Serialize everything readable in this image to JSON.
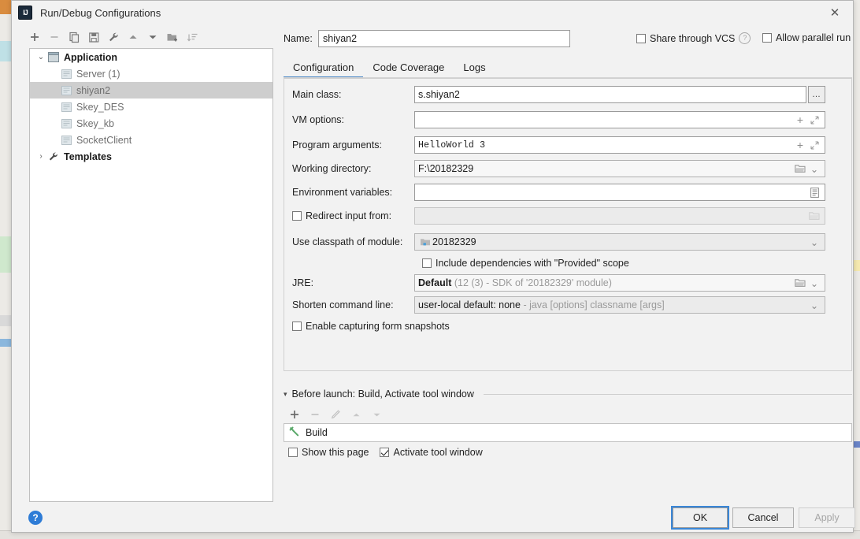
{
  "window": {
    "title": "Run/Debug Configurations",
    "app_icon": "intellij-idea-icon",
    "close_label": "✕"
  },
  "left_toolbar": {
    "buttons": [
      {
        "name": "add-configuration-button",
        "label": "+"
      },
      {
        "name": "remove-configuration-button",
        "label": "−"
      },
      {
        "name": "copy-configuration-button",
        "label": "copy-icon"
      },
      {
        "name": "save-configuration-button",
        "label": "save-icon"
      },
      {
        "name": "edit-templates-button",
        "label": "wrench-icon"
      },
      {
        "name": "move-up-button",
        "label": "arrow-up-icon"
      },
      {
        "name": "move-down-button",
        "label": "arrow-down-icon"
      },
      {
        "name": "new-folder-button",
        "label": "folder-add-icon"
      },
      {
        "name": "sort-configurations-button",
        "label": "sort-icon"
      }
    ]
  },
  "tree": {
    "group": {
      "label": "Application",
      "twisty": "⌄",
      "icon": "application-icon"
    },
    "items": [
      {
        "label": "Server (1)",
        "selected": false
      },
      {
        "label": "shiyan2",
        "selected": true
      },
      {
        "label": "Skey_DES",
        "selected": false
      },
      {
        "label": "Skey_kb",
        "selected": false
      },
      {
        "label": "SocketClient",
        "selected": false
      }
    ],
    "templates": {
      "label": "Templates",
      "twisty": "›",
      "icon": "wrench-icon"
    }
  },
  "name_row": {
    "label": "Name:",
    "value": "shiyan2",
    "placeholder": "",
    "share_vcs_label": "Share through VCS",
    "share_vcs_checked": false,
    "help_glyph": "?",
    "allow_parallel_label": "Allow parallel run",
    "allow_parallel_checked": false
  },
  "tabs": [
    {
      "label": "Configuration",
      "active": true
    },
    {
      "label": "Code Coverage",
      "active": false
    },
    {
      "label": "Logs",
      "active": false
    }
  ],
  "fields": {
    "main_class": {
      "label": "Main class:",
      "value": "s.shiyan2",
      "browse_label": "…"
    },
    "vm_options": {
      "label": "VM options:",
      "value": "",
      "add_glyph": "+",
      "expand_glyph": "expand-icon"
    },
    "program_arguments": {
      "label": "Program arguments:",
      "value": "HelloWorld 3",
      "add_glyph": "+",
      "expand_glyph": "expand-icon"
    },
    "working_directory": {
      "label": "Working directory:",
      "value": "F:\\20182329",
      "folder_glyph": "folder-icon",
      "chevron_glyph": "⌄"
    },
    "environment_variables": {
      "label": "Environment variables:",
      "value": "",
      "list_glyph": "list-icon"
    },
    "redirect_input": {
      "label": "Redirect input from:",
      "checked": false,
      "value": "",
      "folder_glyph": "folder-icon"
    },
    "use_classpath": {
      "label": "Use classpath of module:",
      "value": "20182329",
      "module_glyph": "module-icon",
      "chevron_glyph": "⌄"
    },
    "include_provided": {
      "label": "Include dependencies with \"Provided\" scope",
      "checked": false
    },
    "jre": {
      "label": "JRE:",
      "value": "Default",
      "hint": "(12 (3) - SDK of '20182329' module)",
      "folder_glyph": "folder-icon",
      "chevron_glyph": "⌄"
    },
    "shorten_command_line": {
      "label": "Shorten command line:",
      "value": "user-local default: none",
      "hint": "- java [options] classname [args]",
      "chevron_glyph": "⌄"
    },
    "form_snapshots": {
      "label": "Enable capturing form snapshots",
      "checked": false
    }
  },
  "before_launch": {
    "triangle": "▾",
    "title": "Before launch: Build, Activate tool window",
    "toolbar": [
      {
        "name": "add-task-button",
        "label": "+",
        "enabled": true
      },
      {
        "name": "remove-task-button",
        "label": "−",
        "enabled": false
      },
      {
        "name": "edit-task-button",
        "label": "pencil-icon",
        "enabled": false
      },
      {
        "name": "move-task-up-button",
        "label": "arrow-up-icon",
        "enabled": false
      },
      {
        "name": "move-task-down-button",
        "label": "arrow-down-icon",
        "enabled": false
      }
    ],
    "tasks": [
      {
        "label": "Build",
        "icon": "hammer-icon"
      }
    ],
    "show_page_label": "Show this page",
    "show_page_checked": false,
    "activate_tool_window_label": "Activate tool window",
    "activate_tool_window_checked": true
  },
  "footer": {
    "help_glyph": "?",
    "ok_label": "OK",
    "cancel_label": "Cancel",
    "apply_label": "Apply",
    "apply_enabled": false
  },
  "colors": {
    "accent_blue": "#4a88c7",
    "focus_blue": "#3a87d8",
    "help_blue": "#2e7cd6",
    "selection_gray": "#cecece",
    "hammer_green": "#59a869"
  }
}
